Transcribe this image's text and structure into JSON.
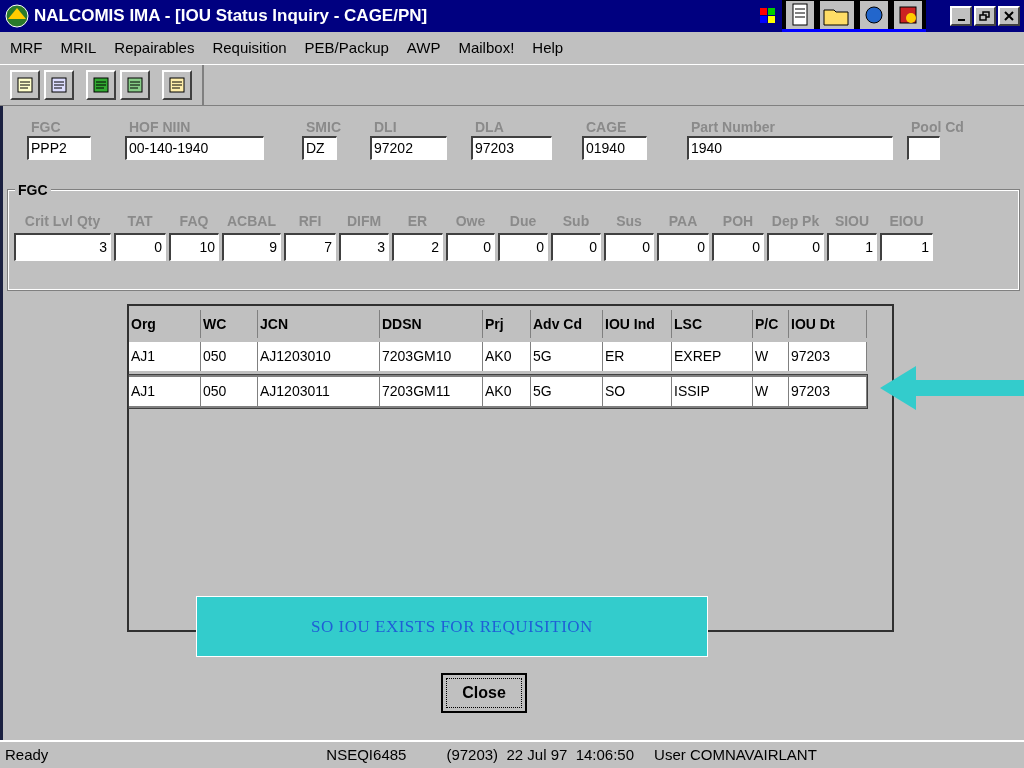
{
  "window": {
    "title": "NALCOMIS IMA - [IOU Status Inquiry - CAGE/PN]"
  },
  "menu": [
    "MRF",
    "MRIL",
    "Repairables",
    "Requisition",
    "PEB/Packup",
    "AWP",
    "Mailbox!",
    "Help"
  ],
  "header_fields": [
    {
      "label": "FGC",
      "value": "PPP2"
    },
    {
      "label": "HOF NIIN",
      "value": "00-140-1940"
    },
    {
      "label": "SMIC",
      "value": "DZ"
    },
    {
      "label": "DLI",
      "value": "97202"
    },
    {
      "label": "DLA",
      "value": "97203"
    },
    {
      "label": "CAGE",
      "value": "01940"
    },
    {
      "label": "Part Number",
      "value": "1940"
    },
    {
      "label": "Pool Cd"
    }
  ],
  "fgc_group": {
    "title": "FGC",
    "fields": [
      {
        "label": "Crit Lvl Qty",
        "value": "3"
      },
      {
        "label": "TAT",
        "value": "0"
      },
      {
        "label": "FAQ",
        "value": "10"
      },
      {
        "label": "ACBAL",
        "value": "9"
      },
      {
        "label": "RFI",
        "value": "7"
      },
      {
        "label": "DIFM",
        "value": "3"
      },
      {
        "label": "ER",
        "value": "2"
      },
      {
        "label": "Owe",
        "value": "0"
      },
      {
        "label": "Due",
        "value": "0"
      },
      {
        "label": "Sub",
        "value": "0"
      },
      {
        "label": "Sus",
        "value": "0"
      },
      {
        "label": "PAA",
        "value": "0"
      },
      {
        "label": "POH",
        "value": "0"
      },
      {
        "label": "Dep Pk",
        "value": "0"
      },
      {
        "label": "SIOU",
        "value": "1"
      },
      {
        "label": "EIOU",
        "value": "1"
      }
    ]
  },
  "table": {
    "columns": [
      "Org",
      "WC",
      "JCN",
      "DDSN",
      "Prj",
      "Adv Cd",
      "IOU Ind",
      "LSC",
      "P/C",
      "IOU Dt"
    ],
    "rows": [
      {
        "cells": [
          "AJ1",
          "050",
          "AJ1203010",
          "7203GM10",
          "AK0",
          "5G",
          "ER",
          "EXREP",
          "W",
          "97203"
        ],
        "highlighted": false
      },
      {
        "cells": [
          "AJ1",
          "050",
          "AJ1203011",
          "7203GM11",
          "AK0",
          "5G",
          "SO",
          "ISSIP",
          "W",
          "97203"
        ],
        "highlighted": true
      }
    ]
  },
  "callout": "SO IOU EXISTS FOR REQUISITION",
  "close_button": "Close",
  "status_bar": [
    "Ready",
    "NSEQI6485",
    "(97203)  22 Jul 97  14:06:50",
    "User COMNAVAIRLANT"
  ]
}
